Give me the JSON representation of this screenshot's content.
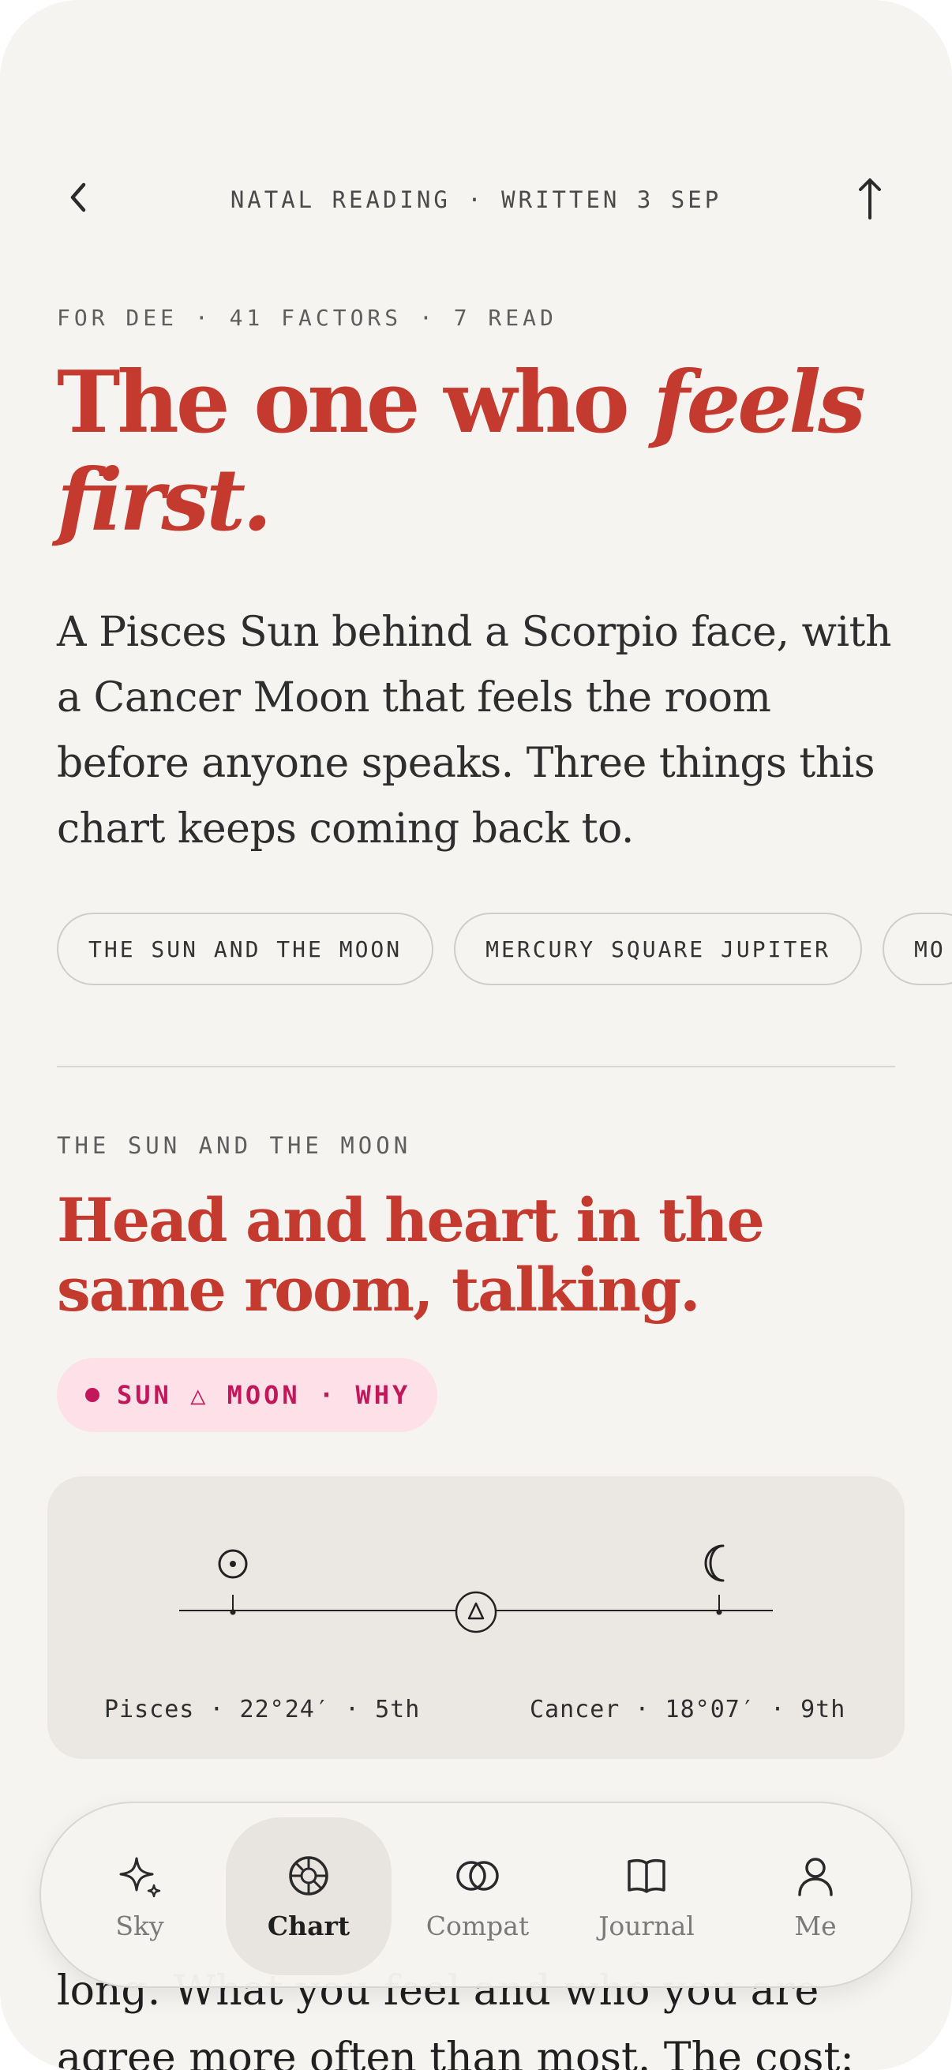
{
  "topbar": {
    "back_icon": "chevron-left-icon",
    "title": "NATAL READING · WRITTEN 3 SEP",
    "share_icon": "arrow-up-icon"
  },
  "reading": {
    "eyebrow": "FOR DEE · 41 FACTORS · 7 READ",
    "headline_plain": "The one who ",
    "headline_em_1": "feels",
    "headline_em_2": "first.",
    "lede": "A Pisces Sun behind a Scorpio face, with a Cancer Moon that feels the room before anyone speaks. Three things this chart keeps coming back to."
  },
  "chips": [
    {
      "label": "THE SUN AND THE MOON"
    },
    {
      "label": "MERCURY SQUARE JUPITER"
    },
    {
      "label": "MO"
    }
  ],
  "section": {
    "eyebrow": "THE SUN AND THE MOON",
    "title": "Head and heart in the same room, talking.",
    "aspect_pill": "SUN △ MOON · WHY",
    "accent_color": "#c2185b",
    "left_position": "Pisces · 22°24′ · 5th",
    "right_position": "Cancer · 18°07′ · 9th",
    "left_icon": "sun-icon",
    "right_icon": "moon-icon",
    "center_icon": "trine-icon",
    "body_text": "long. What you feel and who you are agree more often than most. The cost:"
  },
  "nav": {
    "items": [
      {
        "label": "Sky",
        "icon": "sparkle-icon",
        "active": false
      },
      {
        "label": "Chart",
        "icon": "chart-wheel-icon",
        "active": true
      },
      {
        "label": "Compat",
        "icon": "rings-icon",
        "active": false
      },
      {
        "label": "Journal",
        "icon": "book-icon",
        "active": false
      },
      {
        "label": "Me",
        "icon": "person-icon",
        "active": false
      }
    ]
  },
  "colors": {
    "background": "#f5f4f1",
    "headline": "#c43a2f",
    "card": "#ebe8e3"
  }
}
